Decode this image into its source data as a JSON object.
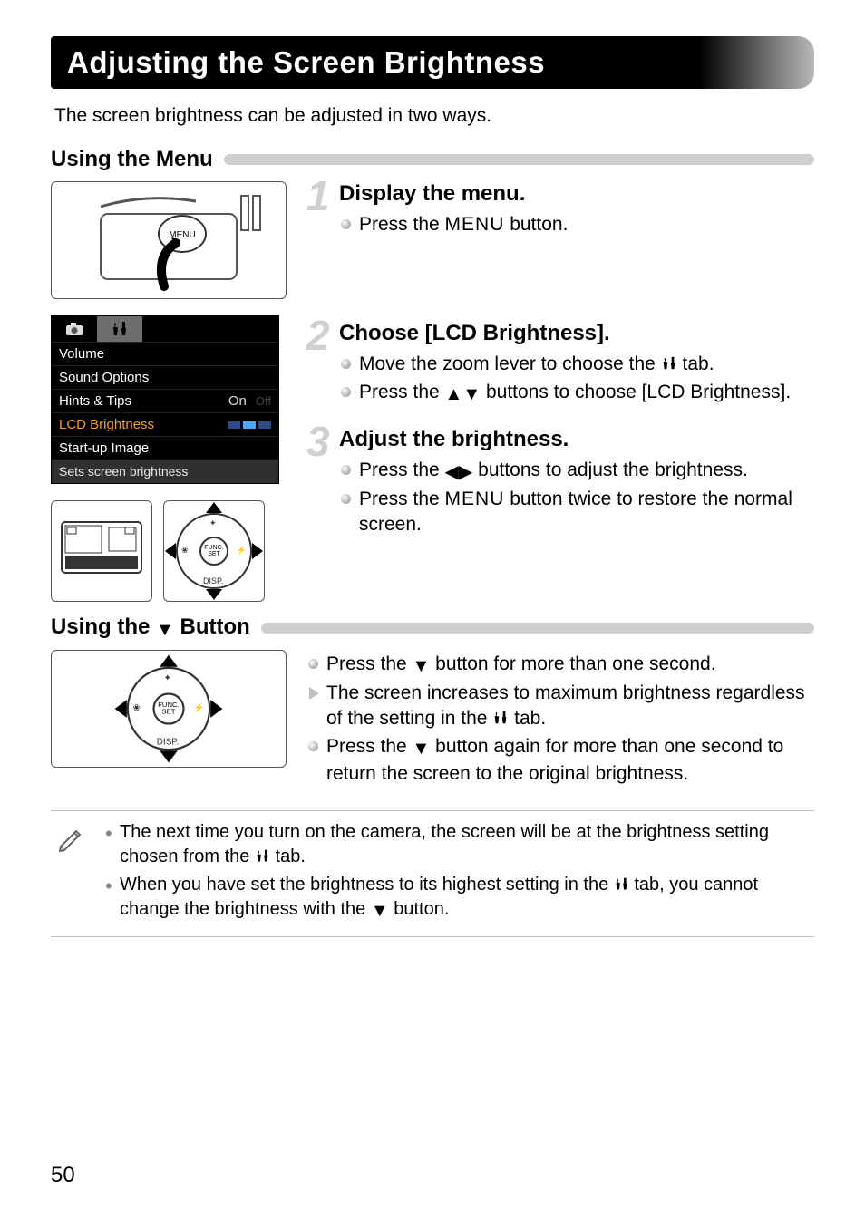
{
  "title": "Adjusting the Screen Brightness",
  "intro": "The screen brightness can be adjusted in two ways.",
  "section1": {
    "heading": "Using the Menu",
    "screen": {
      "rows": [
        "Volume",
        "Sound Options",
        "Hints & Tips",
        "LCD Brightness",
        "Start-up Image"
      ],
      "hints_value": "On",
      "footer": "Sets screen brightness"
    },
    "dpad": {
      "center_top": "FUNC.",
      "center_bot": "SET",
      "label_bottom": "DISP."
    }
  },
  "steps": {
    "s1": {
      "num": "1",
      "title": "Display the menu.",
      "b1_pre": "Press the ",
      "b1_mid": "MENU",
      "b1_post": " button."
    },
    "s2": {
      "num": "2",
      "title": "Choose [LCD Brightness].",
      "b1_pre": "Move the zoom lever to choose the ",
      "b1_post": " tab.",
      "b2_pre": "Press the ",
      "b2_post": " buttons to choose [LCD Brightness]."
    },
    "s3": {
      "num": "3",
      "title": "Adjust the brightness.",
      "b1_pre": "Press the ",
      "b1_post": " buttons to adjust the brightness.",
      "b2_pre": "Press the ",
      "b2_mid": "MENU",
      "b2_post": " button twice to restore the normal screen."
    }
  },
  "section2": {
    "heading_pre": "Using the ",
    "heading_post": " Button",
    "b1_pre": "Press the ",
    "b1_post": " button for more than one second.",
    "b2_pre": "The screen increases to maximum brightness regardless of the setting in the ",
    "b2_post": " tab.",
    "b3_pre": "Press the ",
    "b3_post": " button again for more than one second to return the screen to the original brightness."
  },
  "notes": {
    "n1_pre": "The next time you turn on the camera, the screen will be at the brightness setting chosen from the ",
    "n1_post": " tab.",
    "n2_pre": "When you have set the brightness to its highest setting in the ",
    "n2_mid": " tab, you cannot change the brightness with the ",
    "n2_post": " button."
  },
  "page_number": "50"
}
